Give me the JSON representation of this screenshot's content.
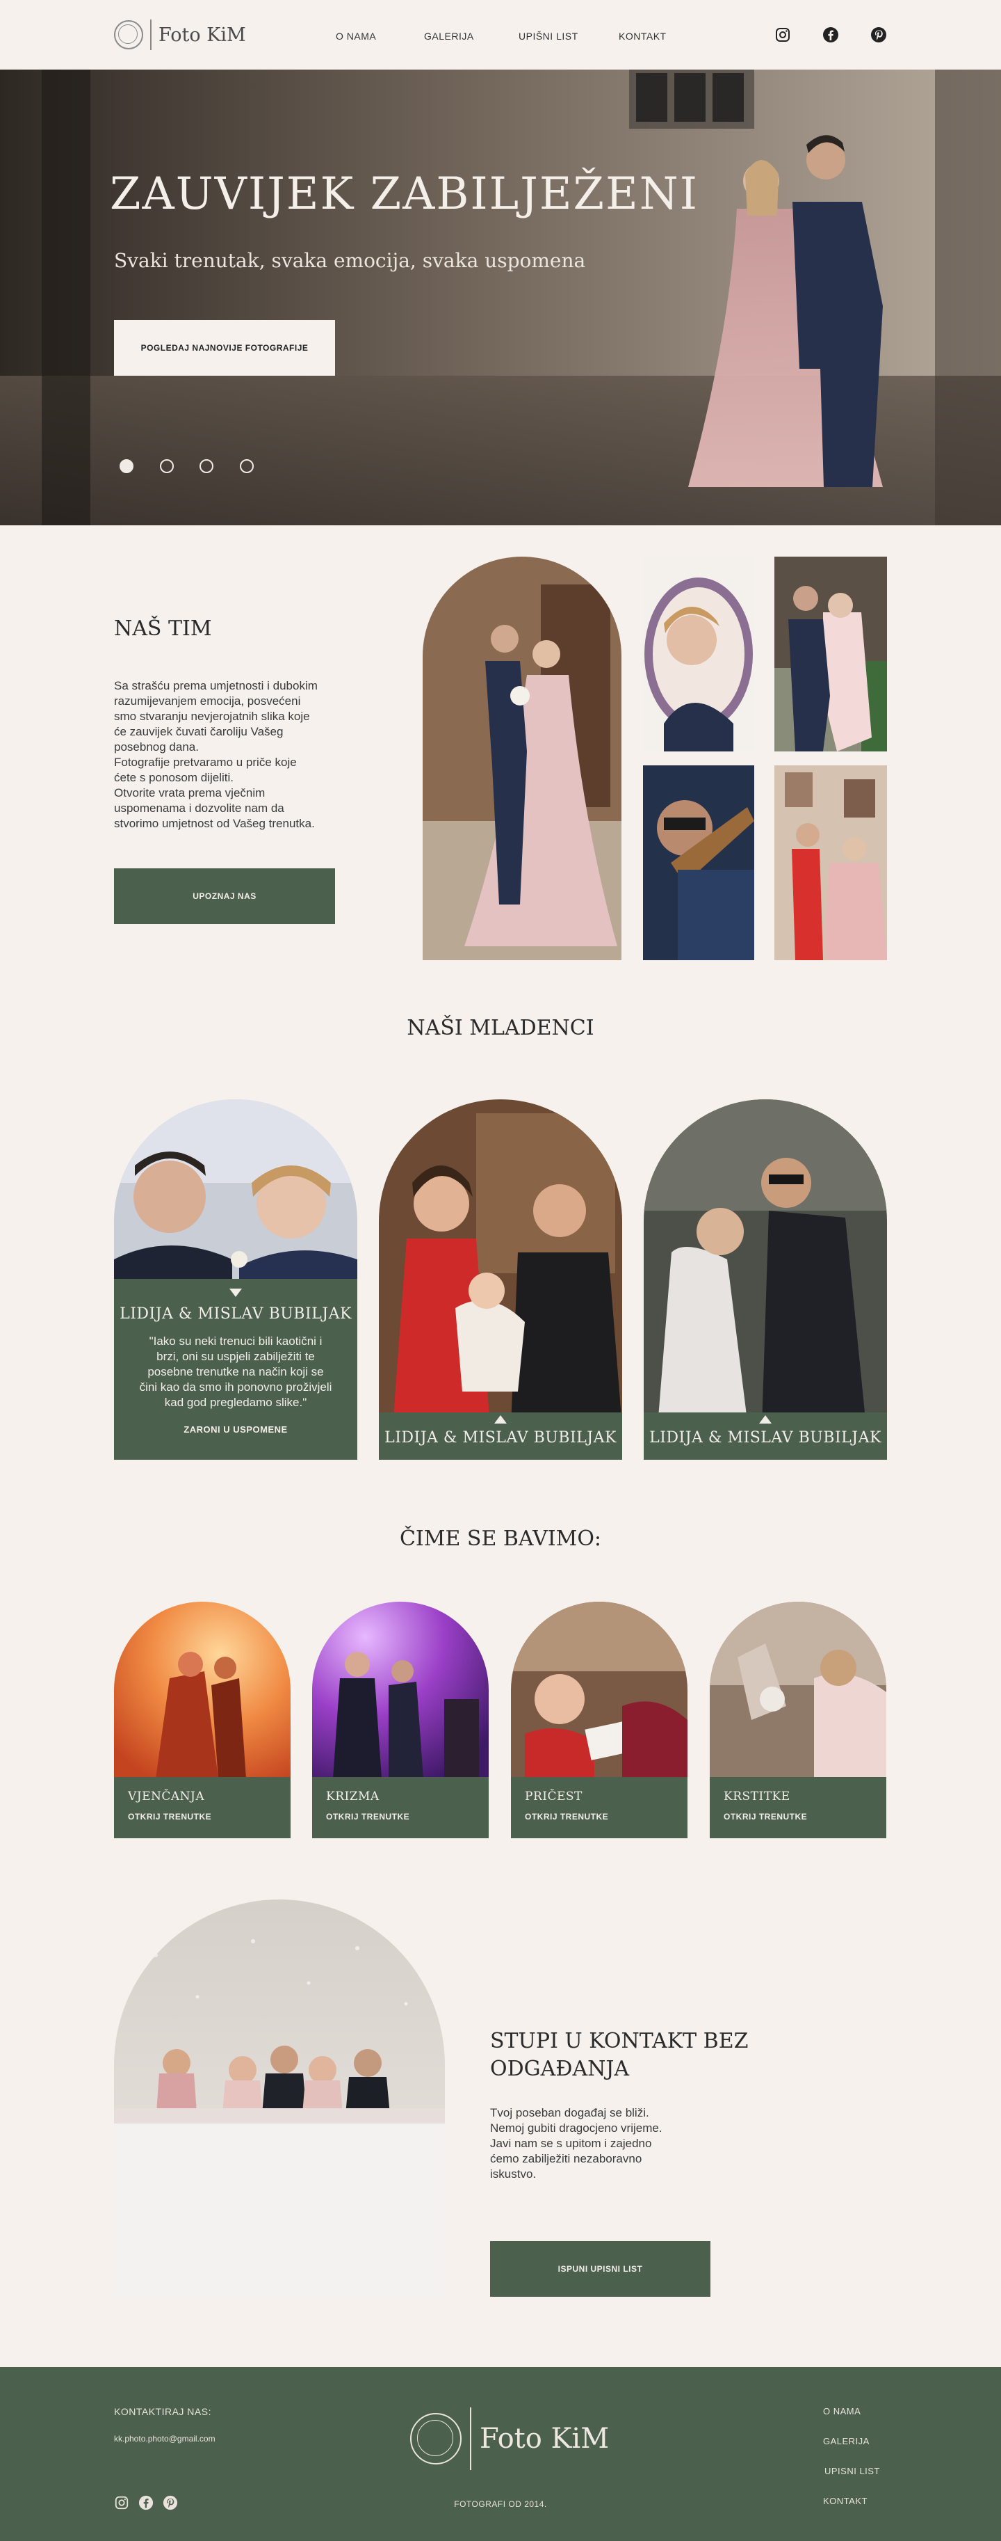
{
  "header": {
    "logo_text": "Foto KiM",
    "nav": [
      "O NAMA",
      "GALERIJA",
      "UPIŠNI LIST",
      "KONTAKT"
    ]
  },
  "hero": {
    "title": "ZAUVIJEK ZABILJEŽENI",
    "subtitle": "Svaki trenutak, svaka emocija, svaka uspomena",
    "button": "POGLEDAJ NAJNOVIJE FOTOGRAFIJE",
    "slides": 4,
    "active_slide": 1
  },
  "team": {
    "heading": "NAŠ TIM",
    "lines": [
      "Sa strašću prema umjetnosti i dubokim",
      "razumijevanjem emocija, posvećeni",
      "smo stvaranju nevjerojatnih slika koje",
      "će zauvijek čuvati čaroliju Vašeg",
      "posebnog dana.",
      "Fotografije pretvaramo u priče koje",
      "ćete s ponosom dijeliti.",
      "Otvorite vrata prema vječnim",
      "uspomenama i dozvolite nam da",
      "stvorimo umjetnost od Vašeg trenutka."
    ],
    "button": "UPOZNAJ NAS"
  },
  "couples": {
    "heading": "NAŠI MLADENCI",
    "items": [
      {
        "name": "LIDIJA & MISLAV BUBILJAK",
        "quote": "\"Iako su neki trenuci bili kaotični i brzi, oni su uspjeli zabilježiti te posebne trenutke na način koji se čini kao da smo ih ponovno proživjeli kad god pregledamo slike.\"",
        "link": "ZARONI U USPOMENE"
      },
      {
        "name": "LIDIJA & MISLAV BUBILJAK"
      },
      {
        "name": "LIDIJA & MISLAV BUBILJAK"
      }
    ]
  },
  "services": {
    "heading": "ČIME SE BAVIMO:",
    "items": [
      {
        "name": "VJENČANJA",
        "link": "OTKRIJ TRENUTKE"
      },
      {
        "name": "KRIZMA",
        "link": "OTKRIJ TRENUTKE"
      },
      {
        "name": "PRIČEST",
        "link": "OTKRIJ TRENUTKE"
      },
      {
        "name": "KRSTITKE",
        "link": "OTKRIJ TRENUTKE"
      }
    ]
  },
  "contact": {
    "heading_line1": "STUPI U KONTAKT BEZ",
    "heading_line2": "ODGAĐANJA",
    "lines": [
      "Tvoj poseban događaj se bliži.",
      "Nemoj gubiti dragocjeno vrijeme.",
      "Javi nam se s upitom i zajedno",
      "ćemo zabilježiti nezaboravno",
      "iskustvo."
    ],
    "button": "ISPUNI UPISNI LIST"
  },
  "footer": {
    "contact_label": "KONTAKTIRAJ NAS:",
    "email": "kk.photo.photo@gmail.com",
    "logo_text": "Foto KiM",
    "since": "FOTOGRAFI OD 2014.",
    "links": [
      "O NAMA",
      "GALERIJA",
      "UPISNI LIST",
      "KONTAKT"
    ]
  },
  "colors": {
    "background": "#f6f1ec",
    "green": "#4b604d",
    "text": "#2d2d2d"
  }
}
